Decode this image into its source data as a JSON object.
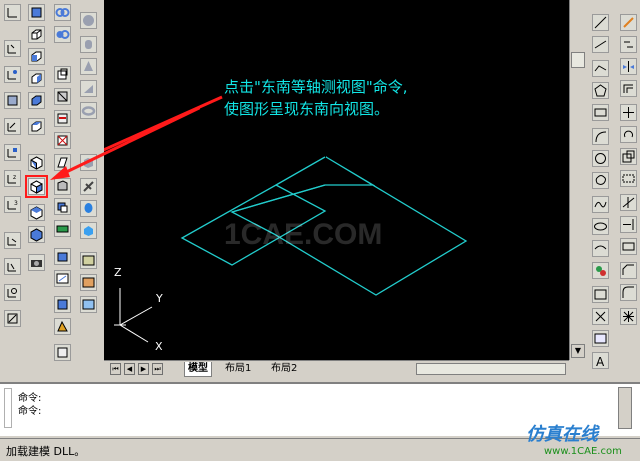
{
  "annotation": {
    "line1": "点击\"东南等轴测视图\"命令,",
    "line2": "使图形呈现东南向视图。"
  },
  "watermark": "1CAE.COM",
  "ucs": {
    "z": "Z",
    "y": "Y",
    "x": "X"
  },
  "layout_tabs": [
    "模型",
    "布局1",
    "布局2"
  ],
  "command": {
    "lines": [
      "命令:",
      "命令:"
    ]
  },
  "status_text": "加载建模 DLL。",
  "branding": {
    "title": "仿真在线",
    "site": "www.1CAE.com"
  },
  "colors": {
    "annotation": "#12e6e6",
    "wireframe": "#22cccc",
    "arrow": "#ff1a1a",
    "canvas": "#000000"
  }
}
